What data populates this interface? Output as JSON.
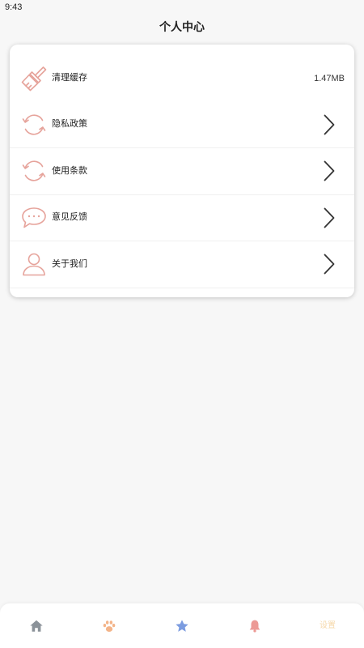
{
  "status_bar": {
    "time": "9:43"
  },
  "header": {
    "title": "个人中心"
  },
  "menu": {
    "items": [
      {
        "icon": "broom-icon",
        "label": "清理缓存",
        "value": "1.47MB"
      },
      {
        "icon": "refresh-icon",
        "label": "隐私政策",
        "trailing_icon": "chevron-right-icon"
      },
      {
        "icon": "refresh-icon",
        "label": "使用条款",
        "trailing_icon": "chevron-right-icon"
      },
      {
        "icon": "chat-bubble-icon",
        "label": "意见反馈",
        "trailing_icon": "chevron-right-icon"
      },
      {
        "icon": "user-icon",
        "label": "关于我们",
        "trailing_icon": "chevron-right-icon"
      }
    ]
  },
  "bottom_nav": {
    "items": [
      {
        "icon": "home-icon",
        "color": "#8b9299"
      },
      {
        "icon": "paw-icon",
        "color": "#f3b489"
      },
      {
        "icon": "star-icon",
        "color": "#7c9ce0"
      },
      {
        "icon": "bell-icon",
        "color": "#ec9a95"
      },
      {
        "label": "设置",
        "color": "#f6d8aa"
      }
    ]
  },
  "colors": {
    "background": "#f7f7f7",
    "card": "#ffffff",
    "menu_icon": "#e6a39b",
    "text": "#222222",
    "chevron": "#333333"
  }
}
